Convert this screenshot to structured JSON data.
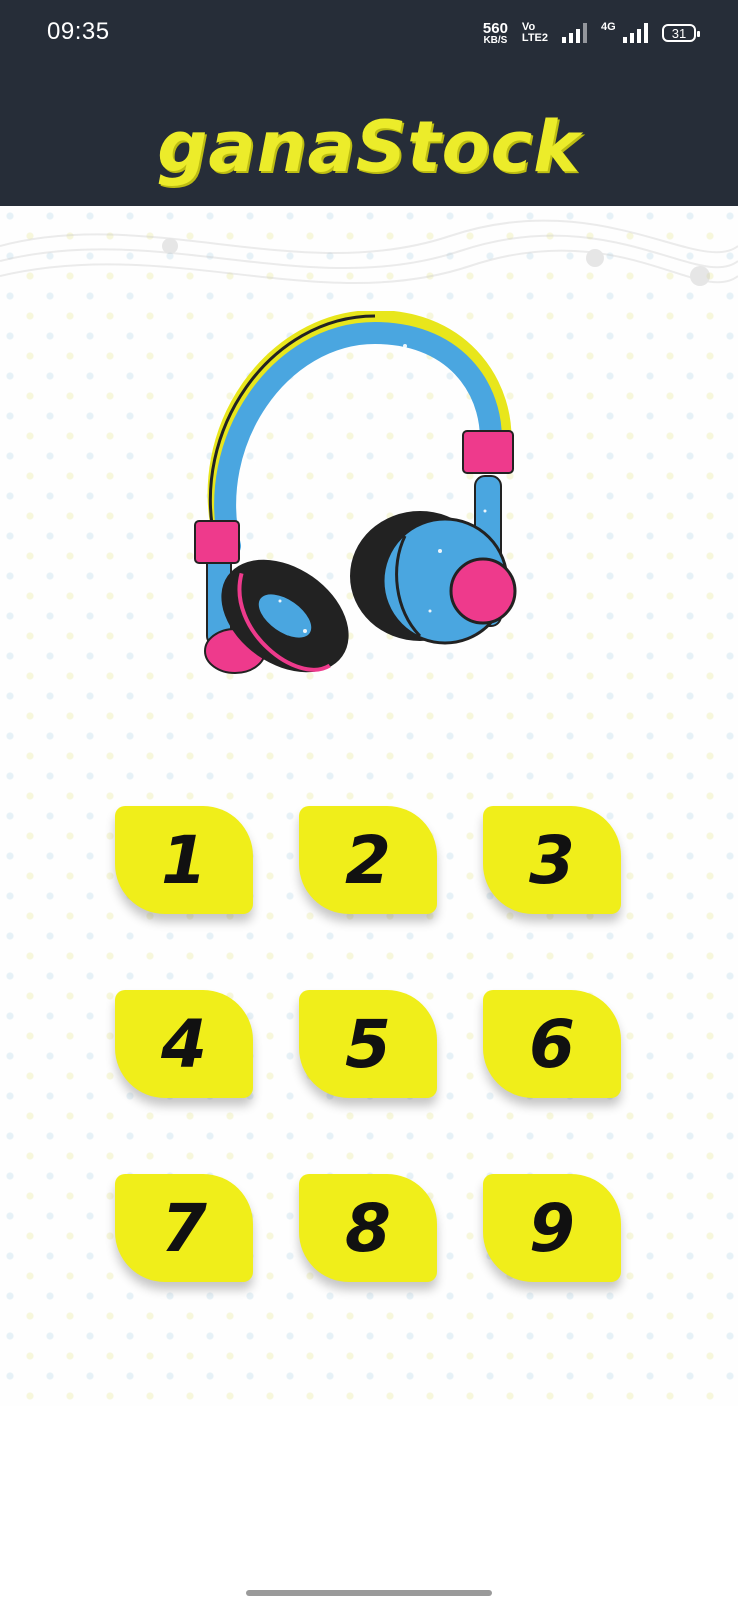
{
  "status_bar": {
    "time": "09:35",
    "net_speed_value": "560",
    "net_speed_unit": "KB/S",
    "volte_line1": "Vo",
    "volte_line2": "LTE2",
    "network_label": "4G",
    "battery": "31"
  },
  "app": {
    "brand": "ganaStock"
  },
  "keypad": {
    "keys": [
      "1",
      "2",
      "3",
      "4",
      "5",
      "6",
      "7",
      "8",
      "9"
    ]
  },
  "colors": {
    "header_bg": "#262d38",
    "brand_yellow": "#ecec2a",
    "key_yellow": "#f0ee1a",
    "headphone_blue": "#4aa6e0",
    "headphone_pink": "#ee3a8c",
    "headphone_dark": "#222222"
  },
  "icons": {
    "hero": "headphones-icon"
  }
}
